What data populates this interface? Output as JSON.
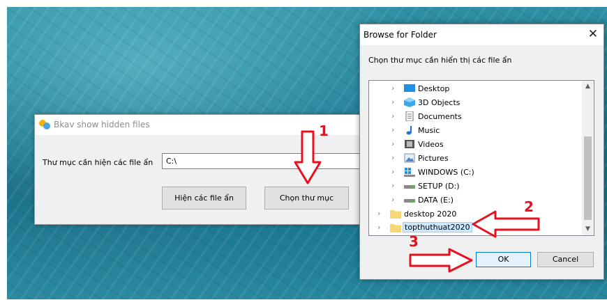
{
  "bkav": {
    "title": "Bkav show hidden files",
    "path_label": "Thư mục cần hiện các file ẩn",
    "path_value": "C:\\",
    "show_button": "Hiện các file ẩn",
    "choose_button": "Chọn thư mục"
  },
  "browse": {
    "title": "Browse for Folder",
    "prompt": "Chọn thư mục cần hiển thị các file ẩn",
    "items": [
      {
        "label": "Desktop",
        "icon": "desktop-icon"
      },
      {
        "label": "3D Objects",
        "icon": "3d-objects-icon"
      },
      {
        "label": "Documents",
        "icon": "documents-icon"
      },
      {
        "label": "Music",
        "icon": "music-icon"
      },
      {
        "label": "Videos",
        "icon": "videos-icon"
      },
      {
        "label": "Pictures",
        "icon": "pictures-icon"
      },
      {
        "label": "WINDOWS (C:)",
        "icon": "windows-drive-icon"
      },
      {
        "label": "SETUP (D:)",
        "icon": "drive-icon"
      },
      {
        "label": "DATA (E:)",
        "icon": "drive-icon"
      },
      {
        "label": "desktop 2020",
        "icon": "folder-icon"
      },
      {
        "label": "topthuthuat2020",
        "icon": "folder-icon",
        "selected": true
      }
    ],
    "ok_button": "OK",
    "cancel_button": "Cancel"
  },
  "annotations": {
    "step1": "1",
    "step2": "2",
    "step3": "3",
    "color": "#e8101e"
  }
}
